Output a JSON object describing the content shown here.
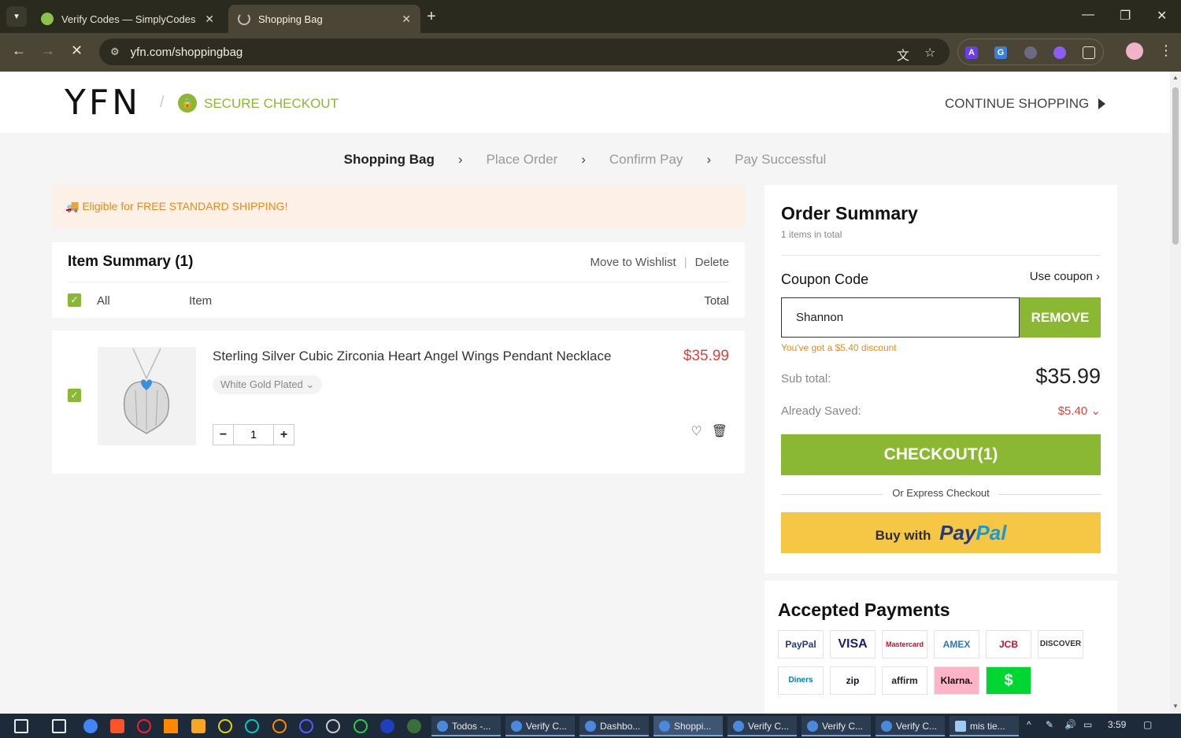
{
  "browser": {
    "tabs": [
      {
        "title": "Verify Codes — SimplyCodes",
        "active": false
      },
      {
        "title": "Shopping Bag",
        "active": true
      }
    ],
    "url": "yfn.com/shoppingbag"
  },
  "header": {
    "logo": "YFN",
    "secure_label": "SECURE CHECKOUT",
    "continue_label": "CONTINUE SHOPPING"
  },
  "steps": [
    "Shopping Bag",
    "Place Order",
    "Confirm Pay",
    "Pay Successful"
  ],
  "shipping_banner": "Eligible for FREE STANDARD SHIPPING!",
  "item_summary": {
    "title": "Item Summary (1)",
    "move_to_wishlist": "Move to Wishlist",
    "delete": "Delete",
    "col_all": "All",
    "col_item": "Item",
    "col_total": "Total"
  },
  "product": {
    "name": "Sterling Silver Cubic Zirconia Heart Angel Wings Pendant Necklace",
    "price": "$35.99",
    "variant": "White Gold Plated",
    "quantity": "1"
  },
  "order_summary": {
    "title": "Order Summary",
    "count": "1 items in total",
    "coupon_label": "Coupon Code",
    "use_coupon": "Use coupon",
    "coupon_value": "Shannon",
    "remove_label": "REMOVE",
    "discount_msg": "You've got a $5.40 discount",
    "subtotal_label": "Sub total:",
    "subtotal_value": "$35.99",
    "saved_label": "Already Saved:",
    "saved_value": "$5.40",
    "checkout_label": "CHECKOUT(1)",
    "express_label": "Or Express Checkout",
    "paypal_prefix": "Buy with",
    "paypal_brand_1": "Pay",
    "paypal_brand_2": "Pal"
  },
  "accepted_payments": {
    "title": "Accepted Payments",
    "methods": [
      "PayPal",
      "VISA",
      "Mastercard",
      "AMEX",
      "JCB",
      "DISCOVER",
      "Diners",
      "zip",
      "affirm",
      "Klarna.",
      "$"
    ]
  },
  "taskbar": {
    "windows": [
      "Todos -...",
      "Verify C...",
      "Dashbo...",
      "Shoppi...",
      "Verify C...",
      "Verify C...",
      "Verify C...",
      "mis tie..."
    ],
    "time": "3:59"
  }
}
